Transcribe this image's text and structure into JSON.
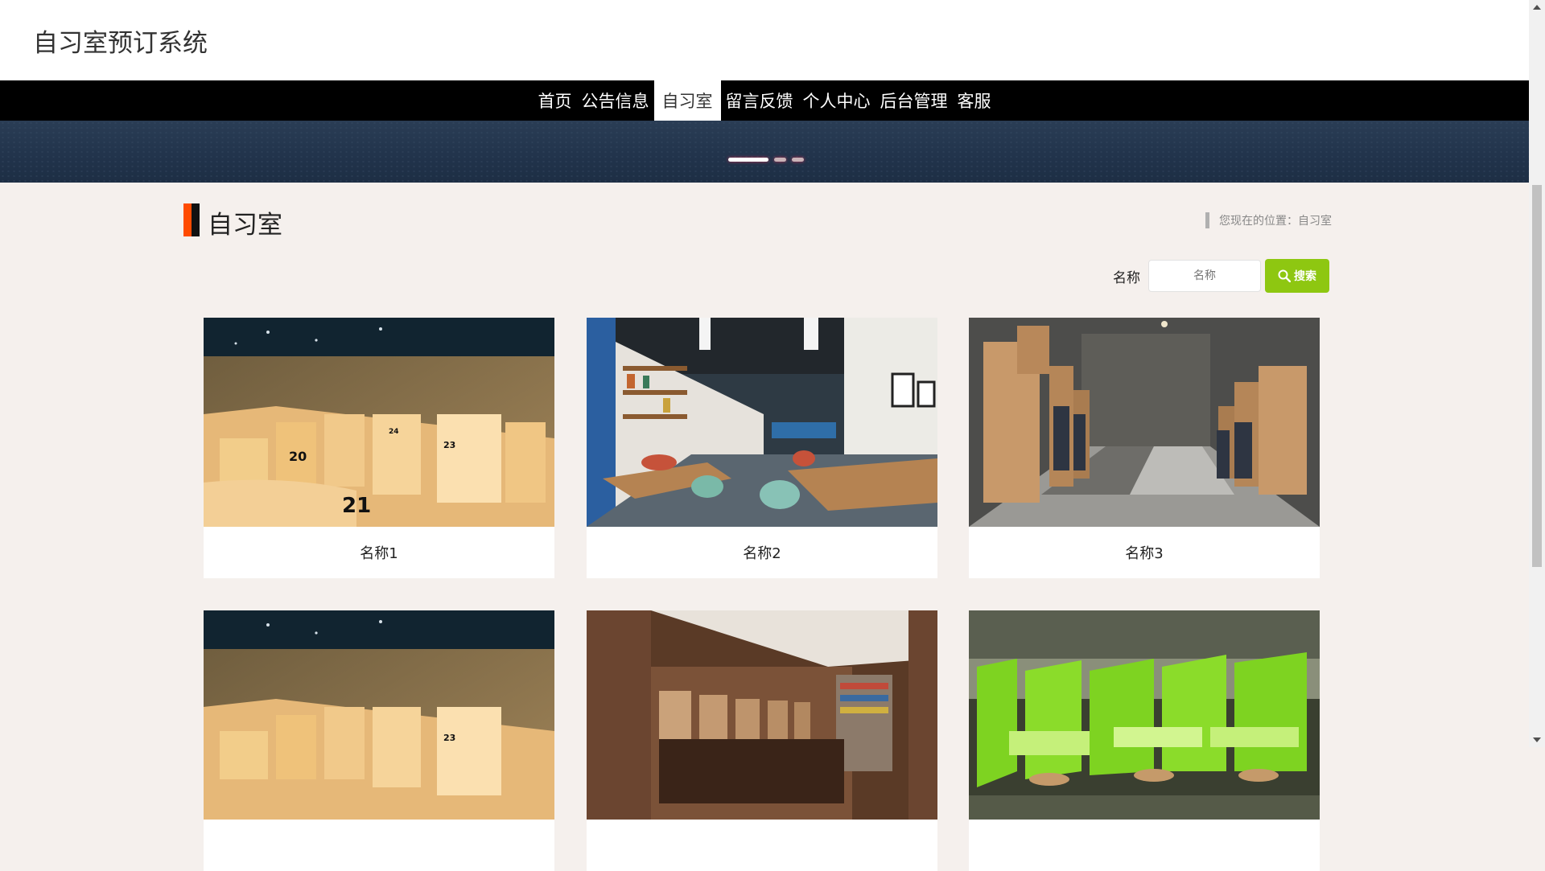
{
  "header": {
    "site_title": "自习室预订系统"
  },
  "nav": {
    "items": [
      {
        "label": "首页"
      },
      {
        "label": "公告信息"
      },
      {
        "label": "自习室"
      },
      {
        "label": "留言反馈"
      },
      {
        "label": "个人中心"
      },
      {
        "label": "后台管理"
      },
      {
        "label": "客服"
      }
    ],
    "active": "自习室"
  },
  "section": {
    "title": "自习室",
    "breadcrumb": "您现在的位置：自习室"
  },
  "search": {
    "label": "名称",
    "placeholder": "名称",
    "button": "搜索"
  },
  "cards": [
    {
      "name": "名称1",
      "image": "study-booths-numbered"
    },
    {
      "name": "名称2",
      "image": "cafe-style-study-room"
    },
    {
      "name": "名称3",
      "image": "gray-study-room-carrels"
    },
    {
      "name": "",
      "image": "study-booths-numbered"
    },
    {
      "name": "",
      "image": "wooden-study-hall"
    },
    {
      "name": "",
      "image": "green-study-booths"
    }
  ],
  "colors": {
    "accent": "#ff4b00",
    "nav_bg": "#000000",
    "search_button": "#8ec711",
    "page_bg": "#f5f0ed"
  }
}
